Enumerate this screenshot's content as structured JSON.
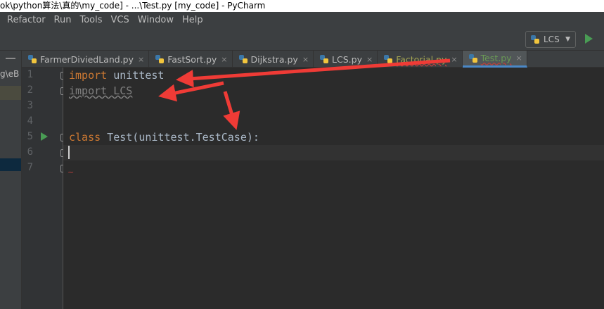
{
  "window": {
    "title": "ok\\python算法\\真的\\my_code] - ...\\Test.py [my_code] - PyCharm"
  },
  "menu": {
    "items": [
      "Refactor",
      "Run",
      "Tools",
      "VCS",
      "Window",
      "Help"
    ]
  },
  "toolbar": {
    "run_config": "LCS"
  },
  "project_strip": {
    "label": "g\\eB"
  },
  "tabs": [
    {
      "label": "FarmerDiviedLand.py",
      "close": "×"
    },
    {
      "label": "FastSort.py",
      "close": "×"
    },
    {
      "label": "Dijkstra.py",
      "close": "×"
    },
    {
      "label": "LCS.py",
      "close": "×"
    },
    {
      "label": "Factorial.py",
      "close": "×"
    },
    {
      "label": "Test.py",
      "close": "×"
    }
  ],
  "line_numbers": [
    "1",
    "2",
    "3",
    "4",
    "5",
    "6",
    "7"
  ],
  "code": {
    "line1_kw": "import",
    "line1_rest": " unittest",
    "line2": "import LCS",
    "line5_kw": "class",
    "line5_rest": " Test(unittest.TestCase):"
  },
  "colors": {
    "accent": "#4a88c7",
    "keyword": "#cc7832",
    "arrow": "#ef3b36",
    "run_green": "#499c54"
  }
}
